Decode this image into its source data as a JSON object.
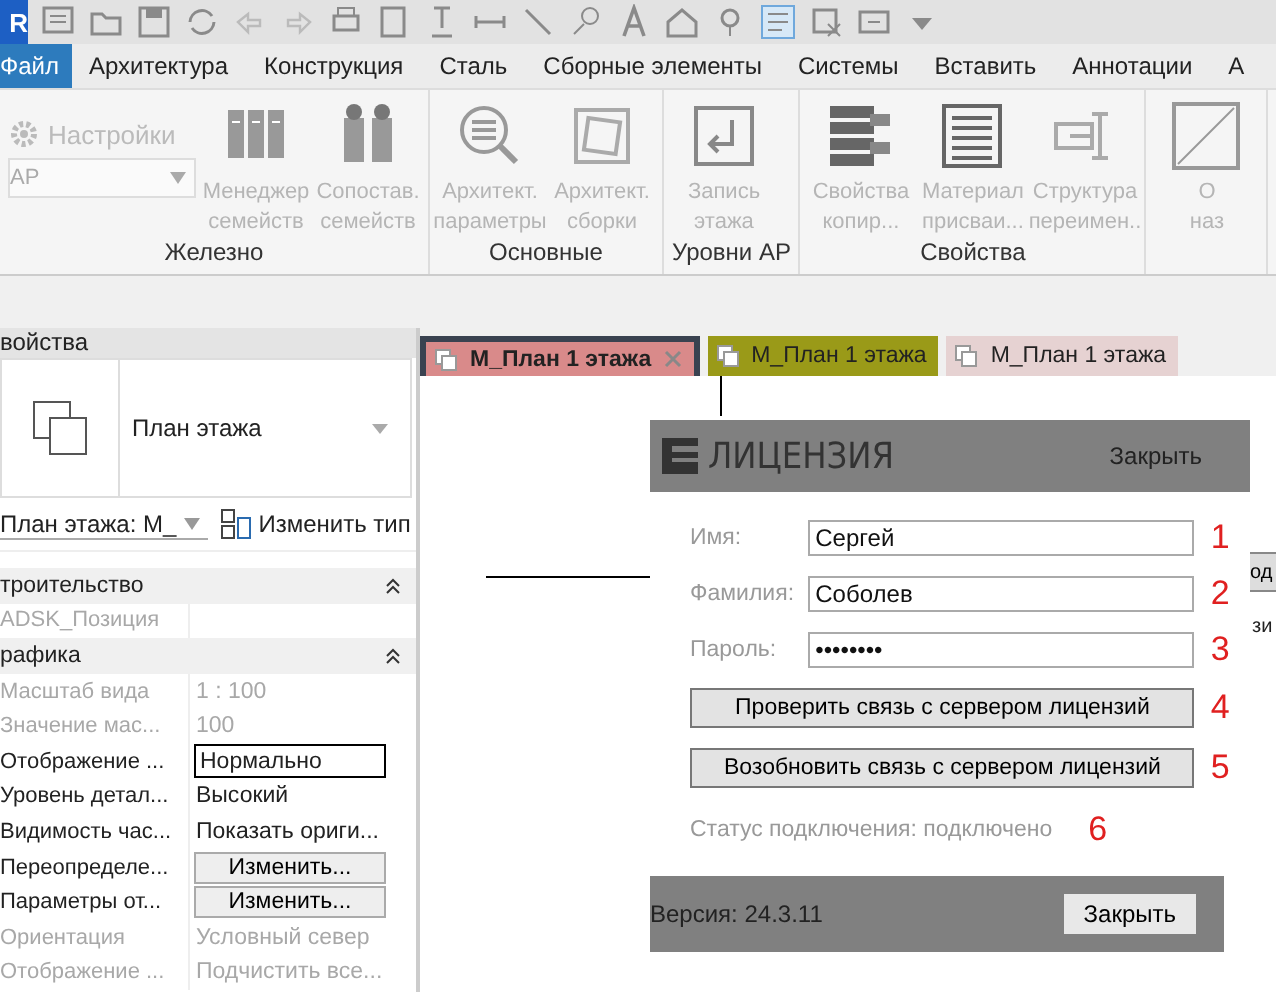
{
  "app_logo": "R",
  "ribbon_tabs": [
    {
      "label": "Файл",
      "selected": true
    },
    {
      "label": "Архитектура",
      "selected": false
    },
    {
      "label": "Конструкция",
      "selected": false
    },
    {
      "label": "Сталь",
      "selected": false
    },
    {
      "label": "Сборные элементы",
      "selected": false
    },
    {
      "label": "Системы",
      "selected": false
    },
    {
      "label": "Вставить",
      "selected": false
    },
    {
      "label": "Аннотации",
      "selected": false
    },
    {
      "label": "А",
      "selected": false
    }
  ],
  "ribbon_panels": [
    {
      "title": "Железно",
      "settings": {
        "label": "Настройки",
        "disabled": true
      },
      "dropdown": {
        "value": "АР",
        "disabled": true
      },
      "buttons": [
        {
          "lines": [
            "Менеджер",
            "семейств"
          ],
          "disabled": true
        },
        {
          "lines": [
            "Сопостав.",
            "семейств"
          ],
          "disabled": true
        }
      ]
    },
    {
      "title": "Основные",
      "buttons": [
        {
          "lines": [
            "Архитект.",
            "параметры"
          ],
          "disabled": true
        },
        {
          "lines": [
            "Архитект.",
            "сборки"
          ],
          "disabled": true
        }
      ]
    },
    {
      "title": "Уровни АР",
      "buttons": [
        {
          "lines": [
            "Запись",
            "этажа"
          ],
          "disabled": true
        }
      ]
    },
    {
      "title": "Свойства",
      "buttons": [
        {
          "lines": [
            "Свойства",
            "копир..."
          ],
          "disabled": true
        },
        {
          "lines": [
            "Материал",
            "присваи..."
          ],
          "disabled": true
        },
        {
          "lines": [
            "Структура",
            "переимен.."
          ],
          "disabled": true
        }
      ]
    },
    {
      "buttons": [
        {
          "lines": [
            "О",
            "наз"
          ],
          "disabled": true
        }
      ]
    }
  ],
  "properties": {
    "title": "войства",
    "type_name": "План этажа",
    "instance_selector": "План этажа: М_",
    "edit_type": "Изменить тип",
    "rows": [
      {
        "kind": "section",
        "name": "троительство"
      },
      {
        "kind": "text",
        "name": "ADSK_Позиция",
        "value": "",
        "disabled": true
      },
      {
        "kind": "section",
        "name": "рафика"
      },
      {
        "kind": "text",
        "name": "Масштаб вида",
        "value": "1 : 100",
        "disabled": true
      },
      {
        "kind": "text",
        "name": "Значение мас...",
        "value": "100",
        "disabled": true
      },
      {
        "kind": "field",
        "name": "Отображение ...",
        "value": "Нормально",
        "disabled": false
      },
      {
        "kind": "text",
        "name": "Уровень детал...",
        "value": "Высокий",
        "disabled": false
      },
      {
        "kind": "text",
        "name": "Видимость час...",
        "value": "Показать ориги...",
        "disabled": false
      },
      {
        "kind": "button",
        "name": "Переопределе...",
        "value": "Изменить...",
        "disabled": false
      },
      {
        "kind": "button",
        "name": "Параметры от...",
        "value": "Изменить...",
        "disabled": false
      },
      {
        "kind": "text",
        "name": "Ориентация",
        "value": "Условный север",
        "disabled": true
      },
      {
        "kind": "text",
        "name": "Отображение ...",
        "value": "Подчистить все...",
        "disabled": true
      }
    ]
  },
  "view_tabs": [
    {
      "label": "М_План 1 этажа",
      "selected": true,
      "color": "#d98a8a"
    },
    {
      "label": "М_План 1 этажа",
      "selected": false,
      "color": "#9a9a18"
    },
    {
      "label": "М_План 1 этажа",
      "selected": false,
      "color": "#e6d2d2"
    }
  ],
  "background_window": {
    "button": "од",
    "text": "зи"
  },
  "license_dialog": {
    "title": "ЛИЦЕНЗИЯ",
    "close_link": "Закрыть",
    "fields": [
      {
        "label": "Имя:",
        "value": "Сергей",
        "marker": "1"
      },
      {
        "label": "Фамилия:",
        "value": "Соболев",
        "marker": "2"
      },
      {
        "label": "Пароль:",
        "value": "••••••••",
        "marker": "3"
      }
    ],
    "buttons": [
      {
        "label": "Проверить связь с сервером лицензий",
        "marker": "4"
      },
      {
        "label": "Возобновить связь с сервером лицензий",
        "marker": "5"
      }
    ],
    "status": "Статус подключения: подключено",
    "status_marker": "6",
    "version": "Версия:  24.3.11",
    "close_button": "Закрыть"
  }
}
